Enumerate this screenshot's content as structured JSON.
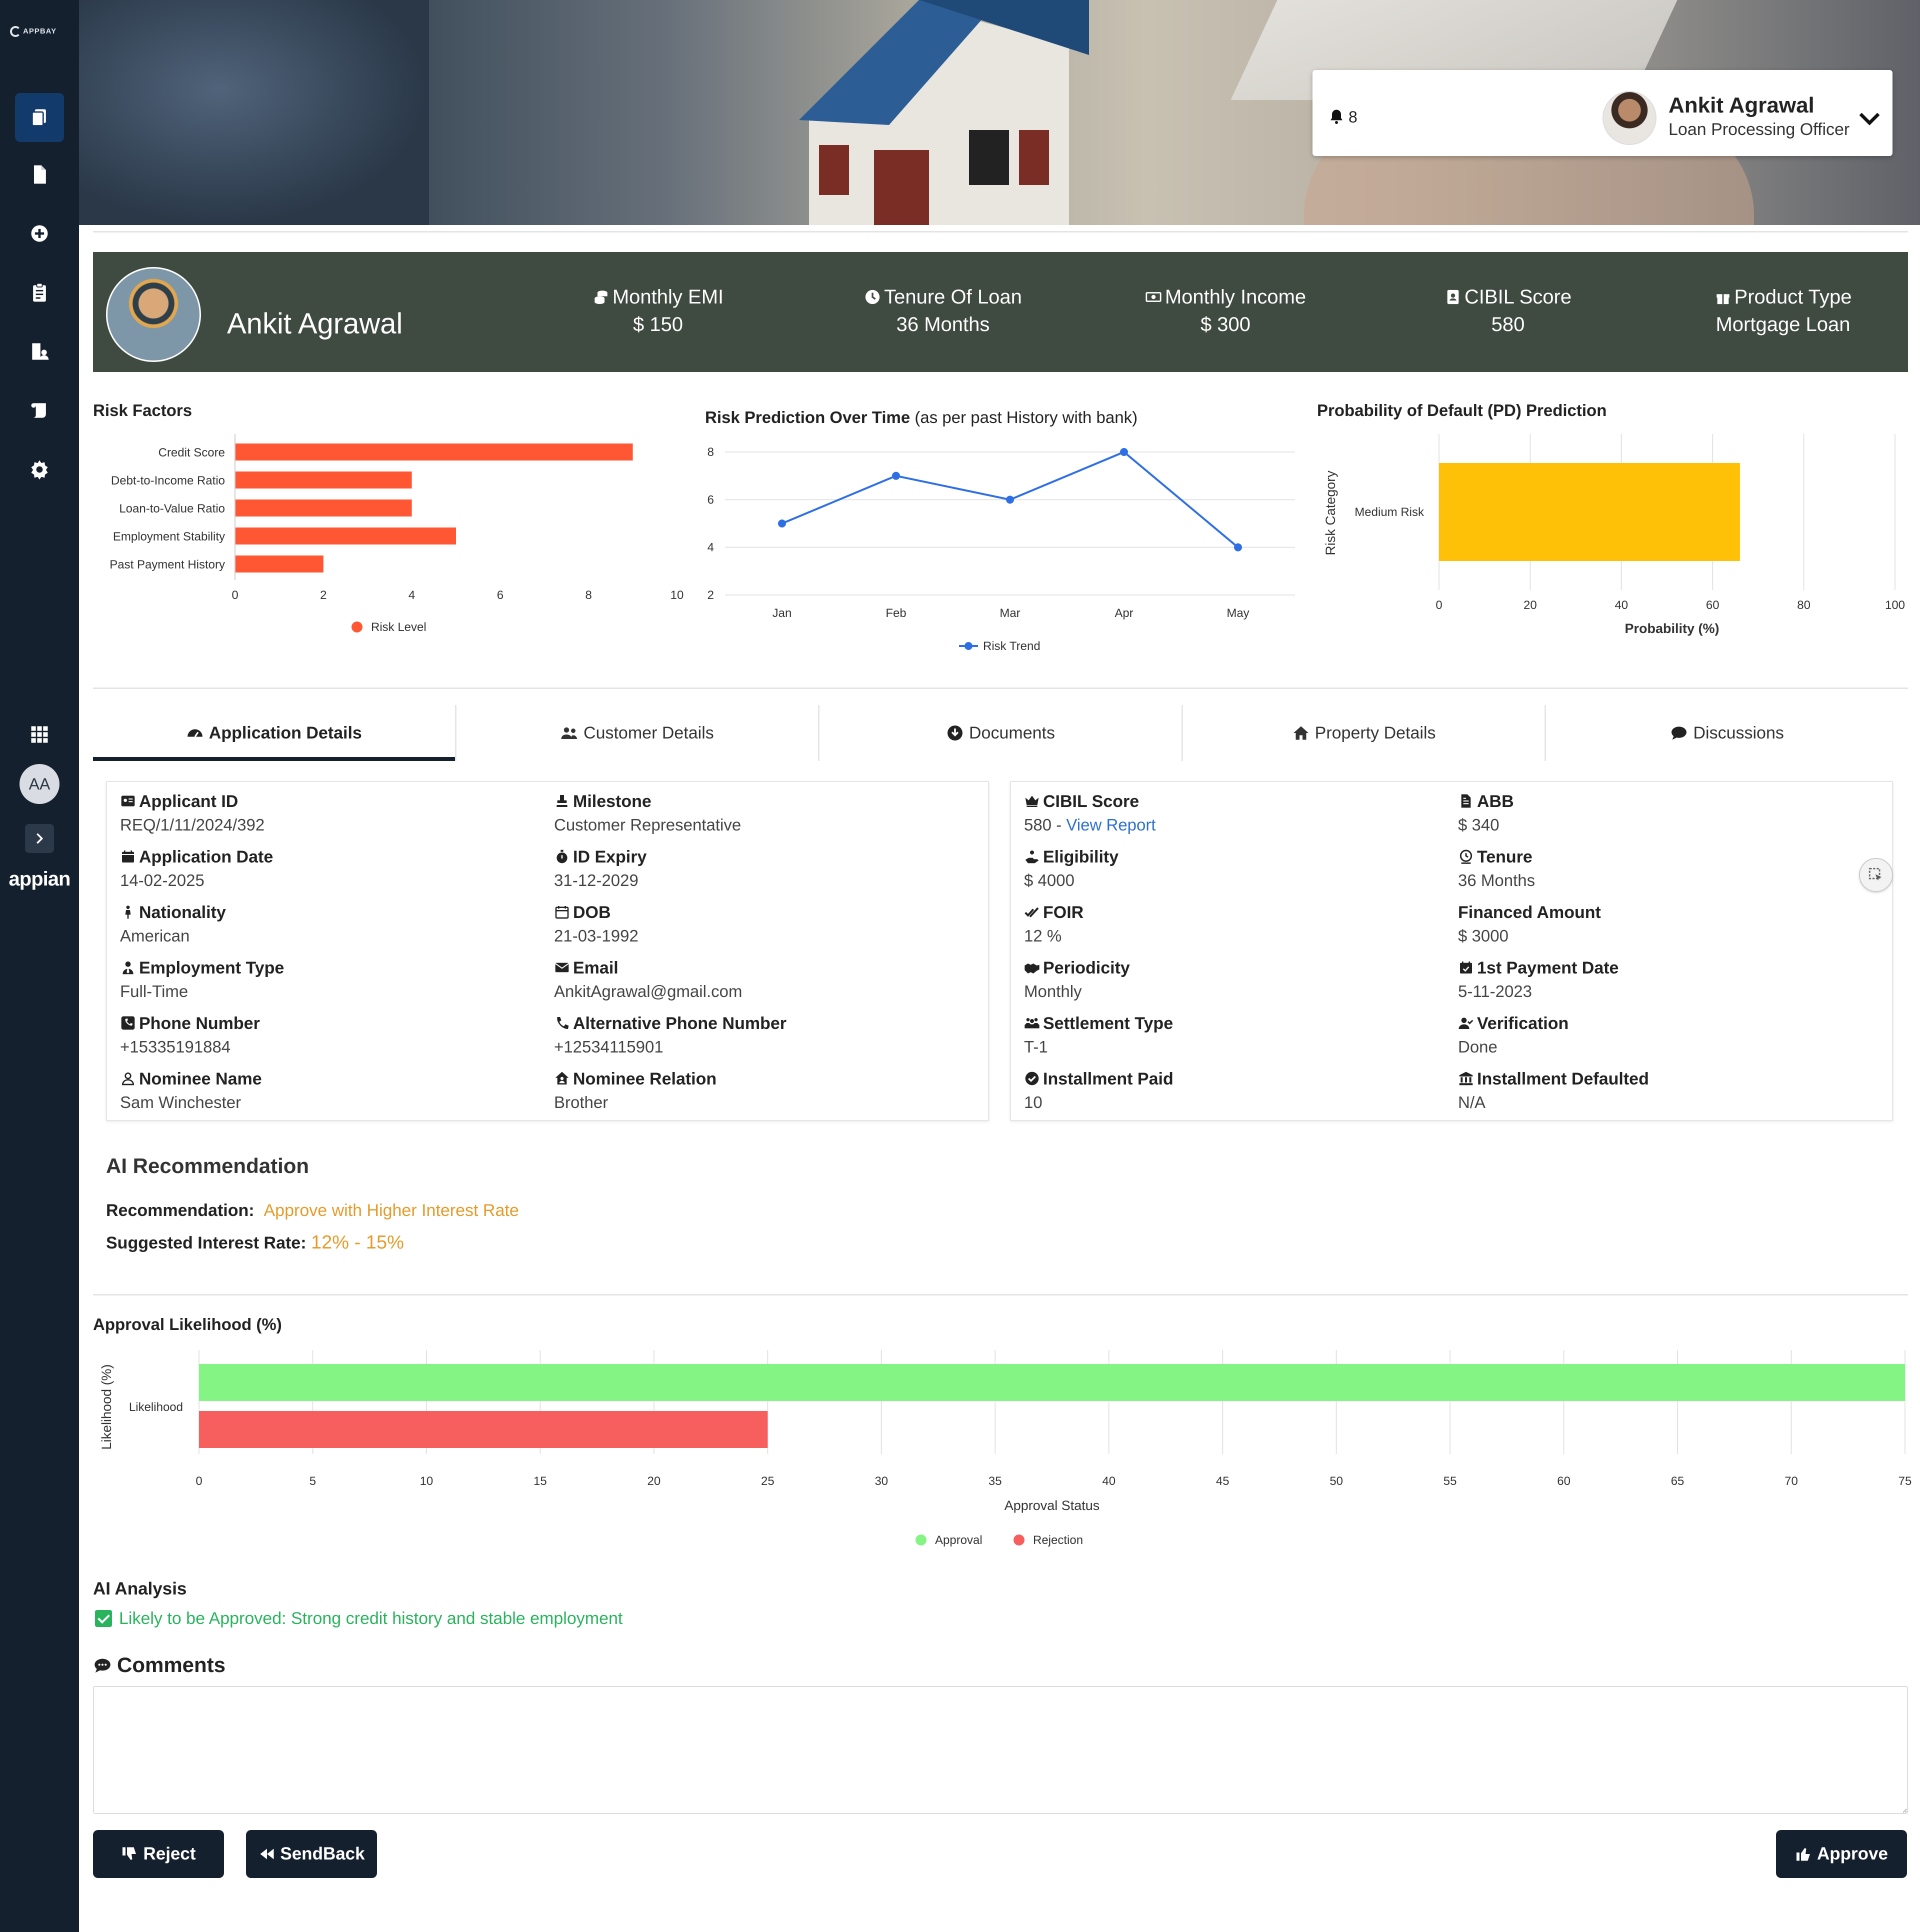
{
  "sidebar": {
    "logo_text": "APPBAY",
    "avatar_initials": "AA",
    "brand": "appian"
  },
  "profile": {
    "notifications_count": "8",
    "name": "Ankit Agrawal",
    "role": "Loan Processing Officer"
  },
  "banner": {
    "name": "Ankit Agrawal",
    "stats": [
      {
        "label": "Monthly EMI",
        "value": "$ 150",
        "icon": "coins-icon"
      },
      {
        "label": "Tenure Of Loan",
        "value": "36 Months",
        "icon": "clock-icon"
      },
      {
        "label": "Monthly Income",
        "value": "$ 300",
        "icon": "money-bill-icon"
      },
      {
        "label": "CIBIL Score",
        "value": "580",
        "icon": "id-card-icon"
      },
      {
        "label": "Product Type",
        "value": "Mortgage Loan",
        "icon": "gift-icon"
      }
    ]
  },
  "risk_factors": {
    "title": "Risk Factors",
    "legend": "Risk Level"
  },
  "risk_prediction": {
    "title": "Risk Prediction Over Time",
    "subtitle": "(as per past History with bank)",
    "legend": "Risk Trend"
  },
  "pd_prediction": {
    "title": "Probability of Default (PD) Prediction",
    "xlabel": "Probability (%)",
    "ylabel": "Risk Category"
  },
  "tabs": [
    {
      "label": "Application Details",
      "icon": "dashboard-icon",
      "active": true
    },
    {
      "label": "Customer Details",
      "icon": "users-icon",
      "active": false
    },
    {
      "label": "Documents",
      "icon": "download-circle-icon",
      "active": false
    },
    {
      "label": "Property Details",
      "icon": "home-icon",
      "active": false
    },
    {
      "label": "Discussions",
      "icon": "comment-icon",
      "active": false
    }
  ],
  "application_details": {
    "left": [
      {
        "label": "Applicant ID",
        "value": "REQ/1/11/2024/392",
        "icon": "id-card-icon"
      },
      {
        "label": "Milestone",
        "value": "Customer Representative",
        "icon": "stamp-icon"
      },
      {
        "label": "Application Date",
        "value": "14-02-2025",
        "icon": "calendar-icon"
      },
      {
        "label": "ID Expiry",
        "value": "31-12-2029",
        "icon": "stopwatch-icon"
      },
      {
        "label": "Nationality",
        "value": "American",
        "icon": "person-icon"
      },
      {
        "label": "DOB",
        "value": "21-03-1992",
        "icon": "calendar-outline-icon"
      },
      {
        "label": "Employment Type",
        "value": "Full-Time",
        "icon": "user-tie-icon"
      },
      {
        "label": "Email",
        "value": "AnkitAgrawal@gmail.com",
        "icon": "envelope-icon"
      },
      {
        "label": "Phone Number",
        "value": "+15335191884",
        "icon": "phone-square-icon"
      },
      {
        "label": "Alternative Phone Number",
        "value": "+12534115901",
        "icon": "phone-icon"
      },
      {
        "label": "Nominee Name",
        "value": "Sam Winchester",
        "icon": "user-outline-icon"
      },
      {
        "label": "Nominee Relation",
        "value": "Brother",
        "icon": "house-user-icon"
      }
    ],
    "right": [
      {
        "label": "CIBIL Score",
        "value": "580 - ",
        "link": "View Report",
        "icon": "crown-icon"
      },
      {
        "label": "ABB",
        "value": "$ 340",
        "icon": "file-invoice-icon"
      },
      {
        "label": "Eligibility",
        "value": "$ 4000",
        "icon": "hand-holding-icon"
      },
      {
        "label": "Tenure",
        "value": "36 Months",
        "icon": "user-clock-icon"
      },
      {
        "label": "FOIR",
        "value": "12 %",
        "icon": "check-double-icon"
      },
      {
        "label": "Financed Amount",
        "value": "$ 3000",
        "icon": ""
      },
      {
        "label": "Periodicity",
        "value": "Monthly",
        "icon": "handshake-icon"
      },
      {
        "label": "1st Payment Date",
        "value": "5-11-2023",
        "icon": "calendar-check-icon"
      },
      {
        "label": "Settlement Type",
        "value": "T-1",
        "icon": "people-group-icon"
      },
      {
        "label": "Verification",
        "value": "Done",
        "icon": "user-check-icon"
      },
      {
        "label": "Installment Paid",
        "value": "10",
        "icon": "circle-check-icon"
      },
      {
        "label": "Installment Defaulted",
        "value": "N/A",
        "icon": "bank-icon"
      }
    ]
  },
  "ai_recommendation": {
    "title": "AI Recommendation",
    "rec_label": "Recommendation:",
    "rec_value": "Approve with Higher Interest Rate",
    "rate_label": "Suggested Interest Rate:",
    "rate_value": "12% - 15%"
  },
  "approval": {
    "title": "Approval Likelihood (%)",
    "xlabel": "Approval Status",
    "ylabel": "Likelihood (%)",
    "legend_approval": "Approval",
    "legend_rejection": "Rejection"
  },
  "ai_analysis": {
    "title": "AI Analysis",
    "text": "Likely to be Approved: Strong credit history and stable employment"
  },
  "comments": {
    "title": "Comments",
    "placeholder": ""
  },
  "buttons": {
    "reject": "Reject",
    "sendback": "SendBack",
    "approve": "Approve"
  },
  "colors": {
    "sidebar": "#15202e",
    "banner": "#3f4a40",
    "risk_bar": "#ff5733",
    "trend_line": "#2f6fe4",
    "pd_bar": "#ffc107",
    "approval": "#84f584",
    "rejection": "#f75e5e",
    "highlight": "#e59a29",
    "analysis_green": "#28b35c"
  },
  "chart_data": [
    {
      "type": "bar",
      "orientation": "horizontal",
      "title": "Risk Factors",
      "categories": [
        "Credit Score",
        "Debt-to-Income Ratio",
        "Loan-to-Value Ratio",
        "Employment Stability",
        "Past Payment History"
      ],
      "series": [
        {
          "name": "Risk Level",
          "values": [
            9,
            4,
            4,
            5,
            2
          ]
        }
      ],
      "xlim": [
        0,
        10
      ],
      "xticks": [
        0,
        2,
        4,
        6,
        8,
        10
      ],
      "legend": "bottom"
    },
    {
      "type": "line",
      "title": "Risk Prediction Over Time",
      "categories": [
        "Jan",
        "Feb",
        "Mar",
        "Apr",
        "May"
      ],
      "series": [
        {
          "name": "Risk Trend",
          "values": [
            5,
            7,
            6,
            8,
            4
          ]
        }
      ],
      "ylim": [
        2,
        8
      ],
      "yticks": [
        2,
        4,
        6,
        8
      ],
      "legend": "bottom"
    },
    {
      "type": "bar",
      "orientation": "horizontal",
      "title": "Probability of Default (PD) Prediction",
      "categories": [
        "Medium Risk"
      ],
      "series": [
        {
          "values": [
            66
          ]
        }
      ],
      "xlim": [
        0,
        100
      ],
      "xticks": [
        0,
        20,
        40,
        60,
        80,
        100
      ],
      "xlabel": "Probability (%)",
      "ylabel": "Risk Category"
    },
    {
      "type": "bar",
      "orientation": "horizontal",
      "title": "Approval Likelihood (%)",
      "categories": [
        "Likelihood"
      ],
      "series": [
        {
          "name": "Approval",
          "values": [
            75
          ]
        },
        {
          "name": "Rejection",
          "values": [
            25
          ]
        }
      ],
      "xlim": [
        0,
        75
      ],
      "xticks": [
        0,
        5,
        10,
        15,
        20,
        25,
        30,
        35,
        40,
        45,
        50,
        55,
        60,
        65,
        70,
        75
      ],
      "xlabel": "Approval Status",
      "ylabel": "Likelihood (%)",
      "legend": "bottom"
    }
  ]
}
